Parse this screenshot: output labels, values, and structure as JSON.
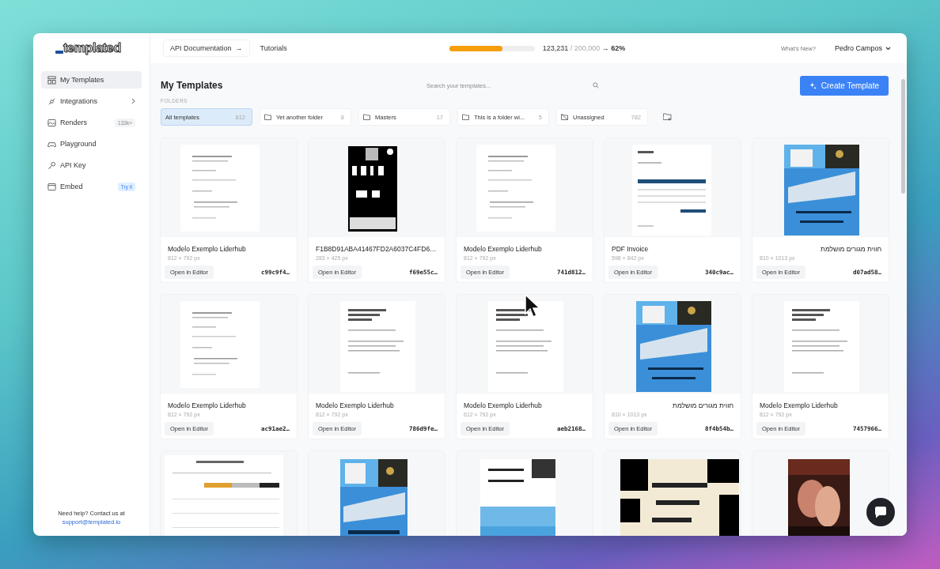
{
  "logo": "templated",
  "nav": [
    {
      "label": "API Documentation",
      "arrow": "→"
    },
    {
      "label": "Tutorials"
    }
  ],
  "usage": {
    "level": 0.62,
    "used": "123,231",
    "total": "/ 200,000",
    "arrow": "→",
    "percent": "62%"
  },
  "whats_new": "What's New?",
  "user": {
    "name": "Pedro Campos"
  },
  "sidebar": {
    "items": [
      {
        "label": "My Templates",
        "selected": true
      },
      {
        "label": "Integrations",
        "selected": false,
        "expandable": true
      },
      {
        "label": "Renders",
        "selected": false,
        "badge": "133k+",
        "kind": "count"
      },
      {
        "label": "Playground",
        "selected": false
      },
      {
        "label": "API Key",
        "selected": false
      },
      {
        "label": "Embed",
        "selected": false,
        "badge": "Try it",
        "kind": "new"
      }
    ],
    "help": {
      "text": "Need help? Contact us at",
      "link": "support@templated.io"
    }
  },
  "page": {
    "title": "My Templates",
    "search": {
      "placeholder": "Search your templates..."
    },
    "create_button": "Create Template",
    "folders_label": "FOLDERS"
  },
  "folders": [
    {
      "name": "All templates",
      "count": "812",
      "kind": "all",
      "selected": true
    },
    {
      "name": "Yet another folder",
      "count": "8",
      "kind": "folder",
      "selected": false
    },
    {
      "name": "Masters",
      "count": "17",
      "kind": "folder",
      "selected": false
    },
    {
      "name": "This is a folder wi...",
      "count": "5",
      "kind": "folder",
      "selected": false
    },
    {
      "name": "Unassigned",
      "count": "782",
      "kind": "unassigned",
      "selected": false
    }
  ],
  "templates": [
    {
      "title": "Modelo Exemplo Liderhub",
      "size": "812 × 792 px",
      "button": "Open in Editor",
      "id": "c99c9f4…"
    },
    {
      "title": "F1B8D91ABA41467FD2A6037C4FD6…",
      "size": "283 × 425 px",
      "button": "Open in Editor",
      "id": "f69e55c…"
    },
    {
      "title": "Modelo Exemplo Liderhub",
      "size": "812 × 792 px",
      "button": "Open in Editor",
      "id": "741d812…"
    },
    {
      "title": "PDF Invoice",
      "size": "598 × 842 px",
      "button": "Open in Editor",
      "id": "340c9ac…"
    },
    {
      "title": "חווית מגורים מושלמת",
      "size": "810 × 1013 px",
      "button": "Open in Editor",
      "id": "d07ad58…"
    },
    {
      "title": "Modelo Exemplo Liderhub",
      "size": "812 × 792 px",
      "button": "Open in Editor",
      "id": "ac91ae2…"
    },
    {
      "title": "Modelo Exemplo Liderhub",
      "size": "812 × 792 px",
      "button": "Open in Editor",
      "id": "786d9fe…"
    },
    {
      "title": "Modelo Exemplo Liderhub",
      "size": "612 × 792 px",
      "button": "Open in Editor",
      "id": "aeb2168…"
    },
    {
      "title": "חווית מגורים מושלמת",
      "size": "810 × 1013 px",
      "button": "Open in Editor",
      "id": "8f4b54b…"
    },
    {
      "title": "Modelo Exemplo Liderhub",
      "size": "812 × 792 px",
      "button": "Open in Editor",
      "id": "7457966…"
    },
    {
      "kind": "picture"
    },
    {
      "kind": "picture"
    },
    {
      "kind": "picture"
    },
    {
      "kind": "picture"
    },
    {
      "kind": "picture"
    }
  ]
}
